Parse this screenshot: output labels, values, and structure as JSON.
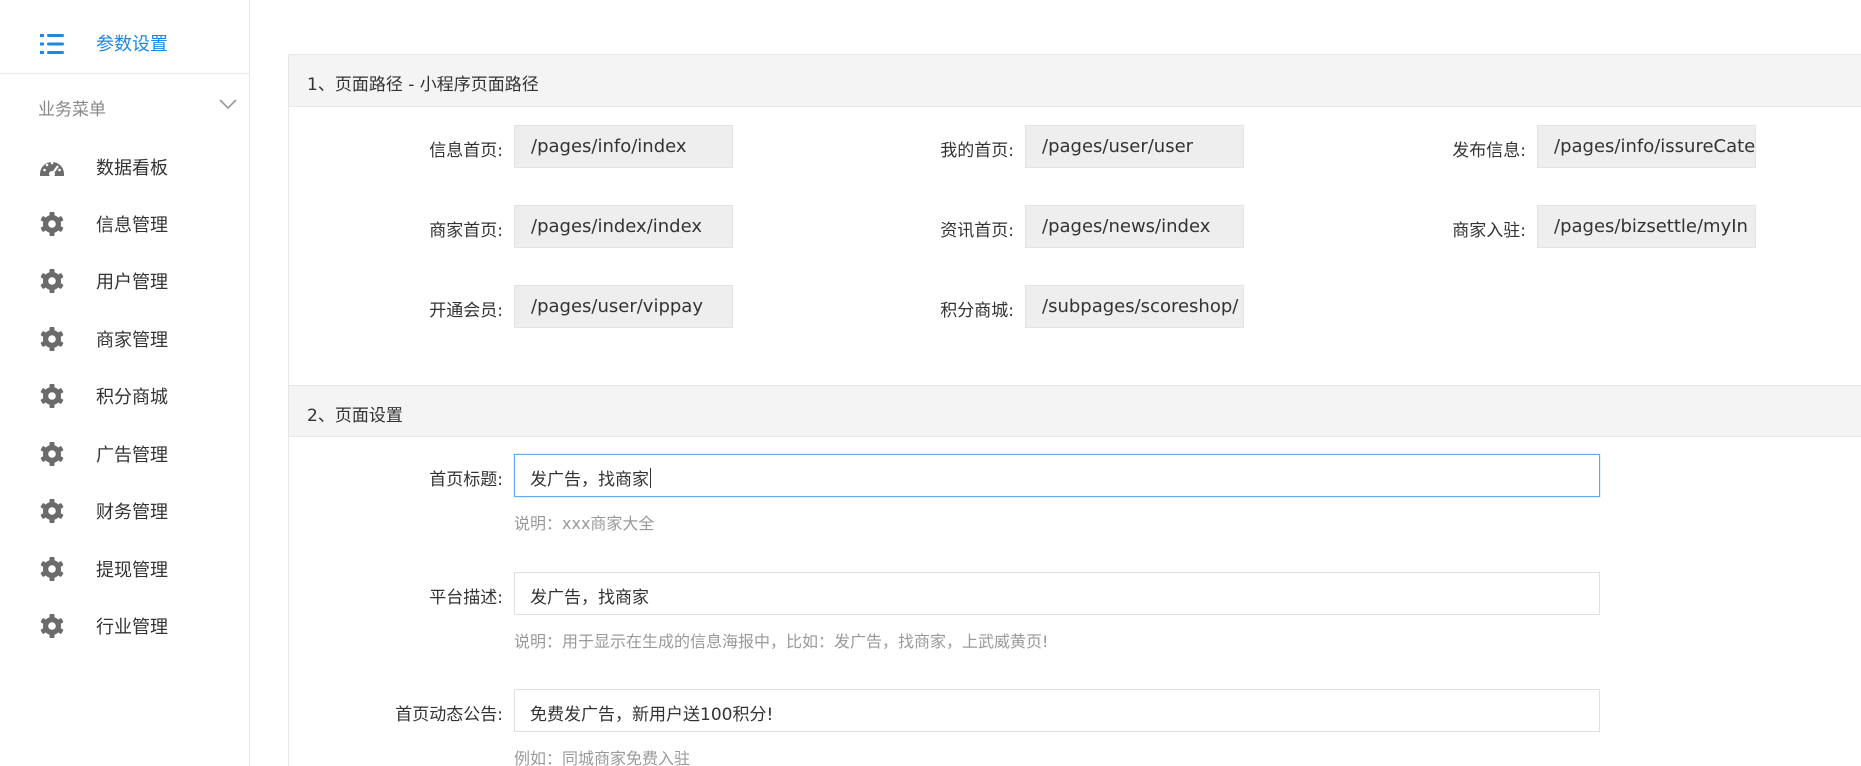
{
  "sidebar": {
    "title": "参数设置",
    "group_label": "业务菜单",
    "items": [
      {
        "label": "数据看板",
        "icon": "dashboard-gauge-icon"
      },
      {
        "label": "信息管理",
        "icon": "gear-icon"
      },
      {
        "label": "用户管理",
        "icon": "gear-icon"
      },
      {
        "label": "商家管理",
        "icon": "gear-icon"
      },
      {
        "label": "积分商城",
        "icon": "gear-icon"
      },
      {
        "label": "广告管理",
        "icon": "gear-icon"
      },
      {
        "label": "财务管理",
        "icon": "gear-icon"
      },
      {
        "label": "提现管理",
        "icon": "gear-icon"
      },
      {
        "label": "行业管理",
        "icon": "gear-icon"
      }
    ]
  },
  "section1": {
    "title": "1、页面路径 - 小程序页面路径",
    "fields": [
      {
        "label": "信息首页:",
        "value": "/pages/info/index"
      },
      {
        "label": "我的首页:",
        "value": "/pages/user/user"
      },
      {
        "label": "发布信息:",
        "value": "/pages/info/issureCate"
      },
      {
        "label": "商家首页:",
        "value": "/pages/index/index"
      },
      {
        "label": "资讯首页:",
        "value": "/pages/news/index"
      },
      {
        "label": "商家入驻:",
        "value": "/pages/bizsettle/myIn"
      },
      {
        "label": "开通会员:",
        "value": "/pages/user/vippay"
      },
      {
        "label": "积分商城:",
        "value": "/subpages/scoreshop/"
      }
    ]
  },
  "section2": {
    "title": "2、页面设置",
    "fields": [
      {
        "label": "首页标题:",
        "value": "发广告，找商家",
        "hint": "说明：xxx商家大全"
      },
      {
        "label": "平台描述:",
        "value": "发广告，找商家",
        "hint": "说明：用于显示在生成的信息海报中，比如：发广告，找商家，上武威黄页!"
      },
      {
        "label": "首页动态公告:",
        "value": "免费发广告，新用户送100积分!",
        "hint": "例如：同城商家免费入驻"
      }
    ]
  },
  "colors": {
    "accent": "#1e88e5",
    "icon": "#6b6b6b",
    "header_bg": "#f4f4f4",
    "readonly_bg": "#eeeeee"
  }
}
